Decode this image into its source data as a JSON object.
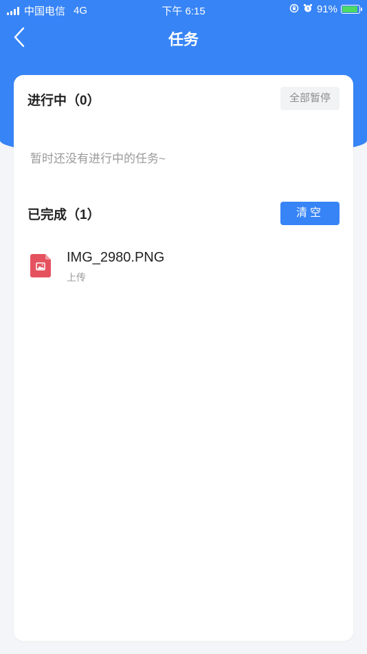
{
  "status_bar": {
    "carrier": "中国电信",
    "network": "4G",
    "time": "下午 6:15",
    "battery": "91%"
  },
  "nav": {
    "title": "任务"
  },
  "in_progress": {
    "title": "进行中（0）",
    "pause_all_label": "全部暂停",
    "empty_text": "暂时还没有进行中的任务~"
  },
  "completed": {
    "title": "已完成（1）",
    "clear_label": "清空",
    "items": [
      {
        "name": "IMG_2980.PNG",
        "type": "上传",
        "icon": "image-file-icon"
      }
    ]
  },
  "colors": {
    "accent": "#3784f6",
    "file_icon": "#e5525f"
  }
}
